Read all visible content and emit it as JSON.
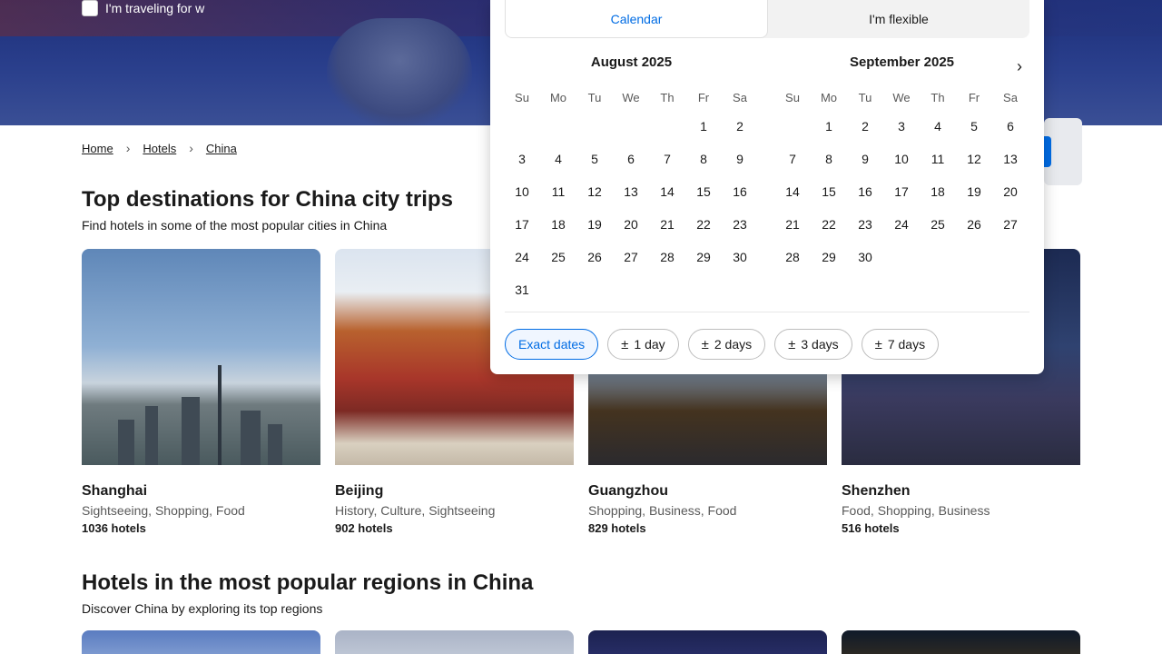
{
  "hero": {
    "traveling_label": "I'm traveling for w"
  },
  "breadcrumb": [
    {
      "label": "Home"
    },
    {
      "label": "Hotels"
    },
    {
      "label": "China"
    }
  ],
  "section1": {
    "title": "Top destinations for China city trips",
    "subtitle": "Find hotels in some of the most popular cities in China"
  },
  "cities": [
    {
      "name": "Shanghai",
      "tags": "Sightseeing, Shopping, Food",
      "count": "1036 hotels"
    },
    {
      "name": "Beijing",
      "tags": "History, Culture, Sightseeing",
      "count": "902 hotels"
    },
    {
      "name": "Guangzhou",
      "tags": "Shopping, Business, Food",
      "count": "829 hotels"
    },
    {
      "name": "Shenzhen",
      "tags": "Food, Shopping, Business",
      "count": "516 hotels"
    }
  ],
  "section2": {
    "title": "Hotels in the most popular regions in China",
    "subtitle": "Discover China by exploring its top regions"
  },
  "datepicker": {
    "tabs": [
      {
        "label": "Calendar"
      },
      {
        "label": "I'm flexible"
      }
    ],
    "weekdays": [
      "Su",
      "Mo",
      "Tu",
      "We",
      "Th",
      "Fr",
      "Sa"
    ],
    "months": [
      {
        "title": "August 2025",
        "offset": 5,
        "days": 31,
        "past_until": 0
      },
      {
        "title": "September 2025",
        "offset": 1,
        "days": 30,
        "past_until": 0
      }
    ],
    "chips": [
      {
        "label": "Exact dates",
        "prefix": ""
      },
      {
        "label": "1 day",
        "prefix": "±"
      },
      {
        "label": "2 days",
        "prefix": "±"
      },
      {
        "label": "3 days",
        "prefix": "±"
      },
      {
        "label": "7 days",
        "prefix": "±"
      }
    ],
    "next_icon": "chevron-right-icon"
  },
  "colors": {
    "accent": "#006ce4",
    "text": "#1a1a1a",
    "muted": "#595959"
  }
}
